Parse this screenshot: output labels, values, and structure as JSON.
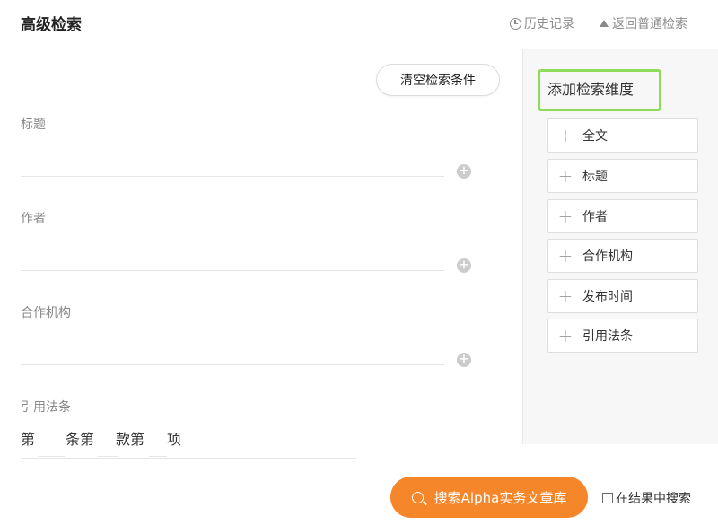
{
  "header": {
    "title": "高级检索",
    "history_label": "历史记录",
    "back_label": "返回普通检索"
  },
  "form": {
    "clear_label": "清空检索条件",
    "fields": [
      {
        "label": "标题"
      },
      {
        "label": "作者"
      },
      {
        "label": "合作机构"
      },
      {
        "label": "引用法条"
      }
    ],
    "law_row": [
      "第",
      "条第",
      "款第",
      "项"
    ]
  },
  "dimensions": {
    "title": "添加检索维度",
    "items": [
      {
        "label": "全文"
      },
      {
        "label": "标题"
      },
      {
        "label": "作者"
      },
      {
        "label": "合作机构"
      },
      {
        "label": "发布时间"
      },
      {
        "label": "引用法条"
      }
    ]
  },
  "actions": {
    "search_label": "搜索Alpha实务文章库",
    "in_results_label": "在结果中搜索"
  },
  "colors": {
    "accent": "#f5872a",
    "highlight_border": "#8ddc5a"
  },
  "icons": {
    "history": "clock-icon",
    "back": "triangle-up-icon",
    "search": "search-icon",
    "add": "plus-icon"
  }
}
